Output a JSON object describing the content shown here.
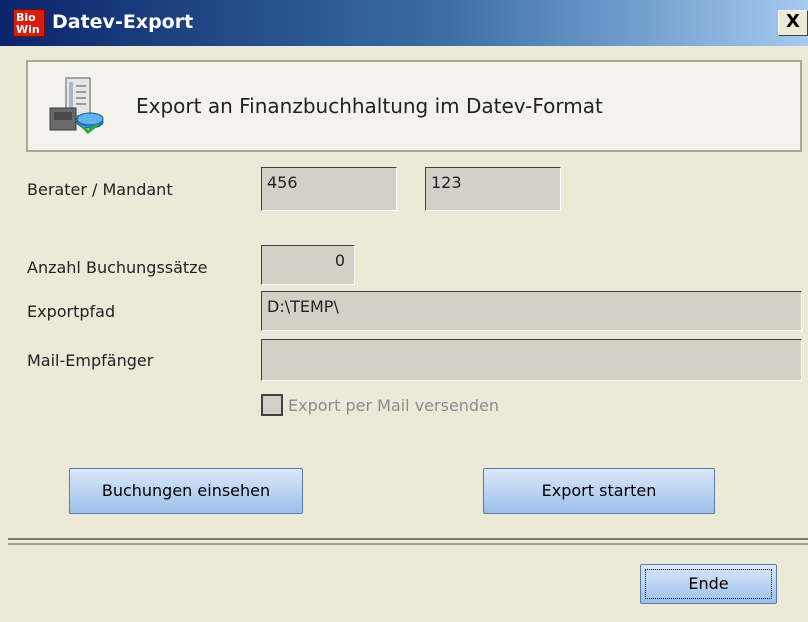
{
  "window": {
    "title": "Datev-Export",
    "app_icon": {
      "line1": "Bio",
      "line2": "Win"
    },
    "close_glyph": "X"
  },
  "header": {
    "text": "Export an Finanzbuchhaltung im Datev-Format",
    "icon": "export-database-icon"
  },
  "fields": {
    "berater_label": "Berater / Mandant",
    "berater_value": "456",
    "mandant_value": "123",
    "anzahl_label": "Anzahl Buchungssätze",
    "anzahl_value": "0",
    "exportpfad_label": "Exportpfad",
    "exportpfad_value": "D:\\TEMP\\",
    "mail_label": "Mail-Empfänger",
    "mail_value": ""
  },
  "checkbox": {
    "label": "Export per Mail versenden",
    "checked": false,
    "enabled": false
  },
  "buttons": {
    "buchungen": "Buchungen einsehen",
    "export": "Export starten",
    "ende": "Ende"
  },
  "colors": {
    "background": "#ece9d8",
    "field_bg": "#d4d0c8",
    "button_top": "#dbe8fa",
    "button_bottom": "#9cc0ea",
    "title_start": "#0a246a",
    "title_end": "#a6caf0",
    "disabled_text": "#8c8c8c"
  }
}
